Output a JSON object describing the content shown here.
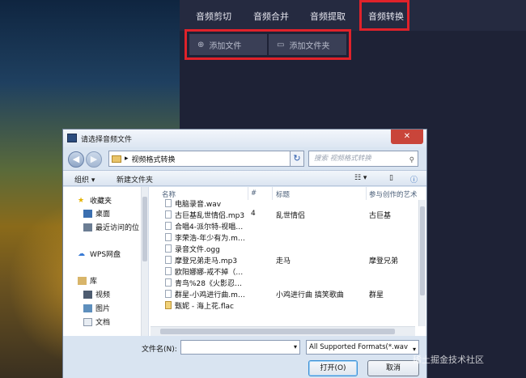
{
  "app": {
    "tabs": [
      {
        "label": "音频剪切"
      },
      {
        "label": "音频合并"
      },
      {
        "label": "音频提取"
      },
      {
        "label": "音频转换"
      }
    ],
    "active_tab_index": 3,
    "toolbar": {
      "add_file_label": "添加文件",
      "add_folder_label": "添加文件夹"
    },
    "accent_color": "#e0222a"
  },
  "dialog": {
    "title": "请选择音频文件",
    "close_glyph": "✕",
    "address": "视频格式转换",
    "search_placeholder": "搜索 视频格式转换",
    "commands": {
      "organize": "组织 ▾",
      "new_folder": "新建文件夹"
    },
    "nav": {
      "favorites": "收藏夹",
      "desktop": "桌面",
      "recent": "最近访问的位",
      "wps": "WPS网盘",
      "libraries": "库",
      "videos": "视频",
      "pictures": "图片",
      "documents": "文档"
    },
    "columns": {
      "name": "名称",
      "number": "#",
      "title": "标题",
      "artist": "参与创作的艺术"
    },
    "files": [
      {
        "name": "电脑录音.wav",
        "number": "",
        "title": "",
        "artist": ""
      },
      {
        "name": "古巨基乱世情侣.mp3",
        "number": "4",
        "title": "乱世情侣",
        "artist": "古巨基"
      },
      {
        "name": "合唱4-派尔特-视唱…",
        "number": "",
        "title": "",
        "artist": ""
      },
      {
        "name": "李荣浩-年少有为.m…",
        "number": "",
        "title": "",
        "artist": ""
      },
      {
        "name": "录音文件.ogg",
        "number": "",
        "title": "",
        "artist": ""
      },
      {
        "name": "摩登兄弟走马.mp3",
        "number": "",
        "title": "走马",
        "artist": "摩登兄弟"
      },
      {
        "name": "欧阳娜娜-戒不掉（…",
        "number": "",
        "title": "",
        "artist": ""
      },
      {
        "name": "青鸟%28《火影忍…",
        "number": "",
        "title": "",
        "artist": ""
      },
      {
        "name": "群星-小鸡进行曲.m…",
        "number": "",
        "title": "小鸡进行曲 搞笑歌曲",
        "artist": "群星"
      },
      {
        "name": "甄妮 - 海上花.flac",
        "number": "",
        "title": "",
        "artist": ""
      }
    ],
    "filename_label": "文件名(N):",
    "filename_value": "",
    "filetype_value": "All Supported Formats(*.wav",
    "open_label": "打开(O)",
    "cancel_label": "取消"
  },
  "watermark": "稀土掘金技术社区"
}
